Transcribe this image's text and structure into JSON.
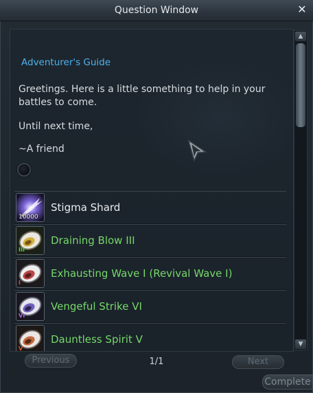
{
  "window": {
    "title": "Question Window",
    "close_glyph": "✕"
  },
  "content": {
    "guide_title": "Adventurer's Guide",
    "paragraphs": [
      "Greetings. Here is a little something to help in your battles to come.",
      "Until next time,",
      "~A friend"
    ]
  },
  "items": [
    {
      "name": "Stigma Shard",
      "quantity": "10000",
      "icon": "stigma-shard-icon",
      "color": "#e9edf0"
    },
    {
      "name": "Draining Blow III",
      "tier": "III",
      "icon": "skill-stone-icon",
      "color": "#76d86a"
    },
    {
      "name": "Exhausting Wave I (Revival Wave I)",
      "tier": "I",
      "icon": "skill-stone-icon",
      "color": "#76d86a"
    },
    {
      "name": "Vengeful Strike VI",
      "tier": "VI",
      "icon": "skill-stone-icon",
      "color": "#76d86a"
    },
    {
      "name": "Dauntless Spirit V",
      "tier": "V",
      "icon": "skill-stone-icon",
      "color": "#76d86a"
    }
  ],
  "pagination": {
    "previous_label": "Previous",
    "next_label": "Next",
    "page_indicator": "1/1"
  },
  "footer": {
    "complete_label": "Complete"
  },
  "colors": {
    "accent_blue": "#4fb2ef",
    "item_green": "#76d86a",
    "text": "#d7dce0"
  }
}
